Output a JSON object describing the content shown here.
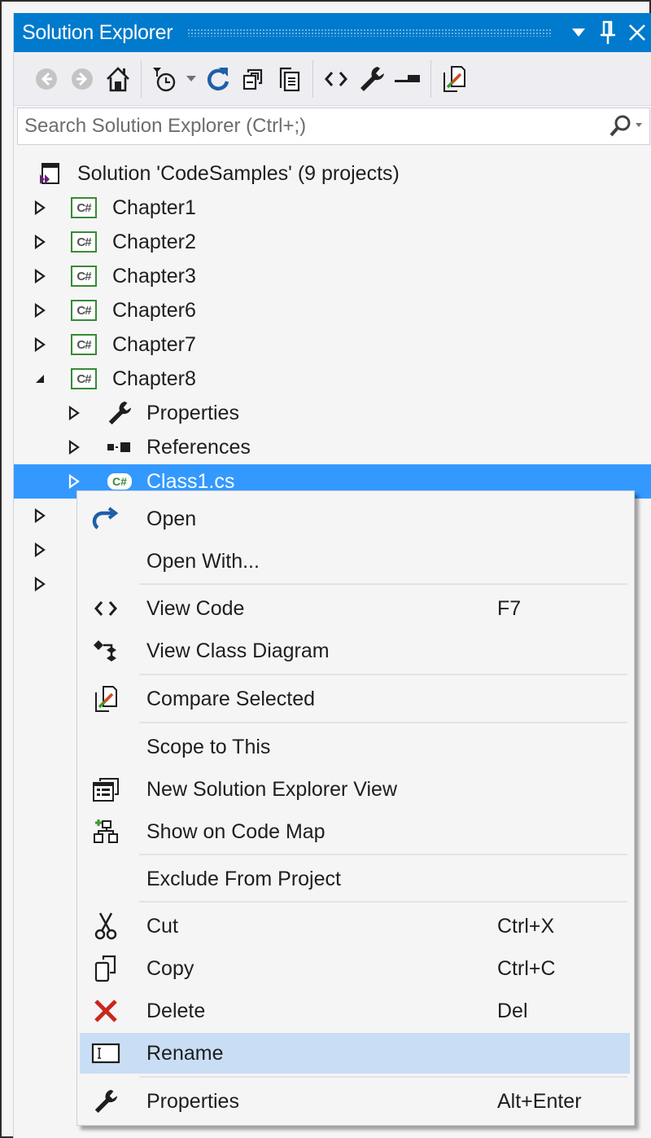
{
  "window": {
    "title": "Solution Explorer",
    "title_buttons": [
      "dropdown-icon",
      "pin-icon",
      "close-icon"
    ]
  },
  "colors": {
    "titlebar": "#007acc",
    "selection": "#3399ff",
    "menu_hover": "#c9def5",
    "csharp_green": "#388a34",
    "delete_red": "#c8281e",
    "refresh_blue": "#1e5fa8"
  },
  "toolbar": {
    "buttons": [
      {
        "name": "back-icon",
        "enabled": false
      },
      {
        "name": "forward-icon",
        "enabled": false
      },
      {
        "name": "home-icon",
        "enabled": true
      },
      {
        "name": "pending-changes-filter-icon",
        "enabled": true
      },
      {
        "name": "filter-dropdown-icon",
        "enabled": true
      },
      {
        "name": "refresh-icon",
        "enabled": true
      },
      {
        "name": "collapse-all-icon",
        "enabled": true
      },
      {
        "name": "show-all-files-icon",
        "enabled": true
      },
      {
        "name": "view-code-icon",
        "enabled": true
      },
      {
        "name": "properties-icon",
        "enabled": true
      },
      {
        "name": "preview-selected-icon",
        "enabled": true
      },
      {
        "name": "compare-icon",
        "enabled": true
      }
    ]
  },
  "search": {
    "placeholder": "Search Solution Explorer (Ctrl+;)",
    "value": ""
  },
  "tree": {
    "solution": {
      "label": "Solution 'CodeSamples' (9 projects)",
      "icon": "visual-studio-solution-icon"
    },
    "items": [
      {
        "label": "Chapter1",
        "icon": "csharp-project-icon",
        "expanded": false,
        "level": 1
      },
      {
        "label": "Chapter2",
        "icon": "csharp-project-icon",
        "expanded": false,
        "level": 1
      },
      {
        "label": "Chapter3",
        "icon": "csharp-project-icon",
        "expanded": false,
        "level": 1
      },
      {
        "label": "Chapter6",
        "icon": "csharp-project-icon",
        "expanded": false,
        "level": 1
      },
      {
        "label": "Chapter7",
        "icon": "csharp-project-icon",
        "expanded": false,
        "level": 1
      },
      {
        "label": "Chapter8",
        "icon": "csharp-project-icon",
        "expanded": true,
        "level": 1
      },
      {
        "label": "Properties",
        "icon": "wrench-icon",
        "expanded": false,
        "level": 2
      },
      {
        "label": "References",
        "icon": "references-icon",
        "expanded": false,
        "level": 2
      },
      {
        "label": "Class1.cs",
        "icon": "csharp-file-icon",
        "expanded": false,
        "level": 2,
        "selected": true
      }
    ],
    "hidden_rows": 3,
    "csharp_badge": "C#"
  },
  "context_menu": {
    "items": [
      {
        "label": "Open",
        "icon": "open-arrow-icon",
        "shortcut": ""
      },
      {
        "label": "Open With...",
        "icon": "",
        "shortcut": ""
      },
      {
        "separator": true
      },
      {
        "label": "View Code",
        "icon": "code-brackets-icon",
        "shortcut": "F7"
      },
      {
        "label": "View Class Diagram",
        "icon": "class-diagram-icon",
        "shortcut": ""
      },
      {
        "separator": true
      },
      {
        "label": "Compare Selected",
        "icon": "compare-icon",
        "shortcut": ""
      },
      {
        "separator": true
      },
      {
        "label": "Scope to This",
        "icon": "",
        "shortcut": ""
      },
      {
        "label": "New Solution Explorer View",
        "icon": "new-view-icon",
        "shortcut": ""
      },
      {
        "label": "Show on Code Map",
        "icon": "code-map-icon",
        "shortcut": ""
      },
      {
        "separator": true
      },
      {
        "label": "Exclude From Project",
        "icon": "",
        "shortcut": ""
      },
      {
        "separator": true
      },
      {
        "label": "Cut",
        "icon": "scissors-icon",
        "shortcut": "Ctrl+X"
      },
      {
        "label": "Copy",
        "icon": "copy-icon",
        "shortcut": "Ctrl+C"
      },
      {
        "label": "Delete",
        "icon": "delete-x-icon",
        "shortcut": "Del"
      },
      {
        "label": "Rename",
        "icon": "rename-icon",
        "shortcut": "",
        "hovered": true
      },
      {
        "separator": true
      },
      {
        "label": "Properties",
        "icon": "wrench-icon",
        "shortcut": "Alt+Enter"
      }
    ]
  }
}
